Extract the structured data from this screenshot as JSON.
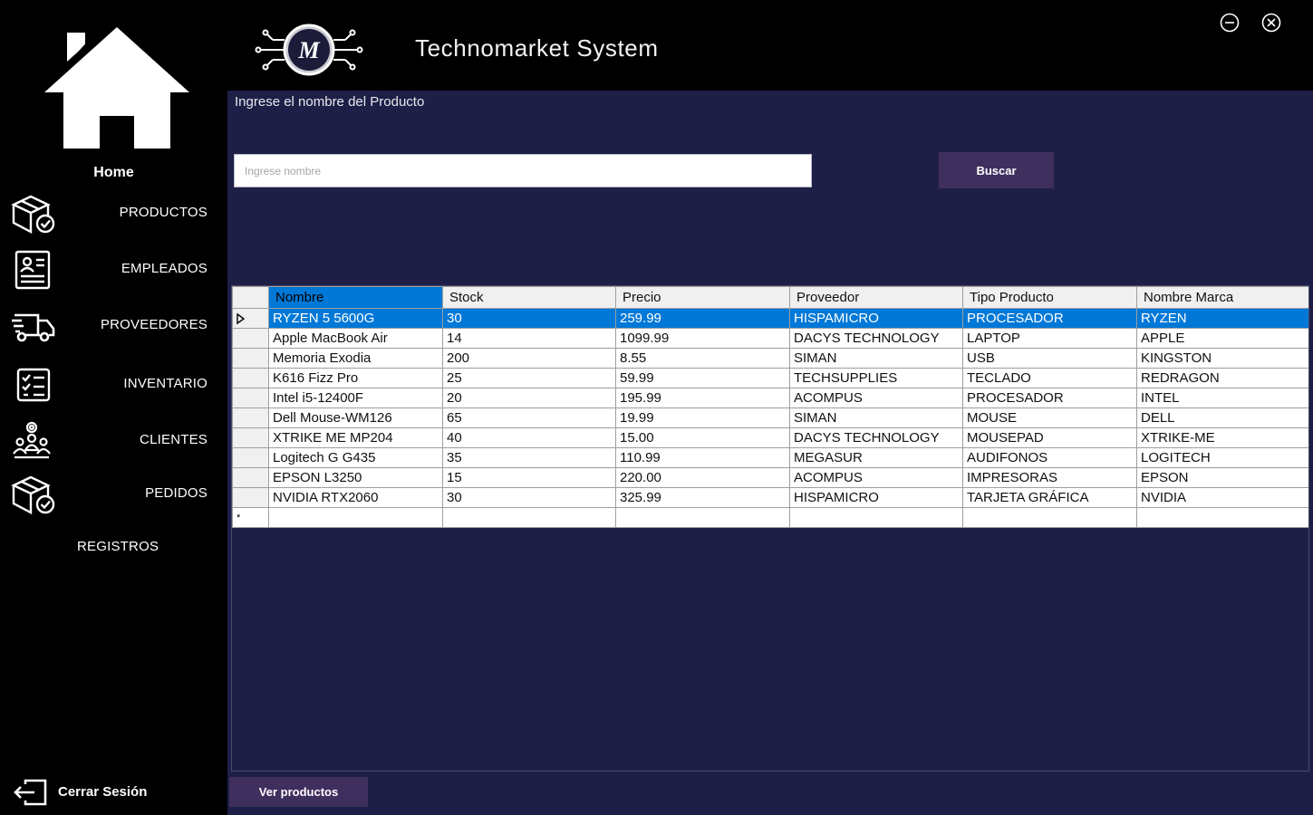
{
  "app": {
    "title": "Technomarket System"
  },
  "sidebar": {
    "home_label": "Home",
    "items": [
      {
        "label": "PRODUCTOS",
        "icon": "box-check-icon"
      },
      {
        "label": "EMPLEADOS",
        "icon": "id-card-icon"
      },
      {
        "label": "PROVEEDORES",
        "icon": "delivery-truck-icon"
      },
      {
        "label": "INVENTARIO",
        "icon": "checklist-icon"
      },
      {
        "label": "CLIENTES",
        "icon": "users-group-icon"
      },
      {
        "label": "PEDIDOS",
        "icon": "box-check-icon"
      },
      {
        "label": "REGISTROS",
        "icon": ""
      }
    ],
    "logout_label": "Cerrar Sesión"
  },
  "search": {
    "label": "Ingrese el nombre del Producto",
    "placeholder": "Ingrese nombre",
    "value": "",
    "button_label": "Buscar"
  },
  "grid": {
    "columns": [
      "Nombre",
      "Stock",
      "Precio",
      "Proveedor",
      "Tipo Producto",
      "Nombre Marca"
    ],
    "rows": [
      [
        "RYZEN 5 5600G",
        "30",
        "259.99",
        "HISPAMICRO",
        "PROCESADOR",
        "RYZEN"
      ],
      [
        "Apple MacBook Air",
        "14",
        "1099.99",
        "DACYS TECHNOLOGY",
        "LAPTOP",
        "APPLE"
      ],
      [
        "Memoria Exodia",
        "200",
        "8.55",
        "SIMAN",
        "USB",
        "KINGSTON"
      ],
      [
        "K616 Fizz Pro",
        "25",
        "59.99",
        "TECHSUPPLIES",
        "TECLADO",
        "REDRAGON"
      ],
      [
        "Intel i5-12400F",
        "20",
        "195.99",
        "ACOMPUS",
        "PROCESADOR",
        "INTEL"
      ],
      [
        "Dell Mouse-WM126",
        "65",
        "19.99",
        "SIMAN",
        "MOUSE",
        "DELL"
      ],
      [
        "XTRIKE ME MP204",
        "40",
        "15.00",
        "DACYS TECHNOLOGY",
        "MOUSEPAD",
        "XTRIKE-ME"
      ],
      [
        "Logitech G G435",
        "35",
        "110.99",
        "MEGASUR",
        "AUDIFONOS",
        "LOGITECH"
      ],
      [
        "EPSON L3250",
        "15",
        "220.00",
        "ACOMPUS",
        "IMPRESORAS",
        "EPSON"
      ],
      [
        "NVIDIA RTX2060",
        "30",
        "325.99",
        "HISPAMICRO",
        "TARJETA GRÁFICA",
        "NVIDIA"
      ]
    ],
    "selected_row": 0,
    "new_row_marker": "*"
  },
  "footer": {
    "view_button_label": "Ver productos"
  },
  "colors": {
    "main_bg": "#1e1f47",
    "button_bg": "#3f2f5f",
    "selection": "#0078d7"
  }
}
